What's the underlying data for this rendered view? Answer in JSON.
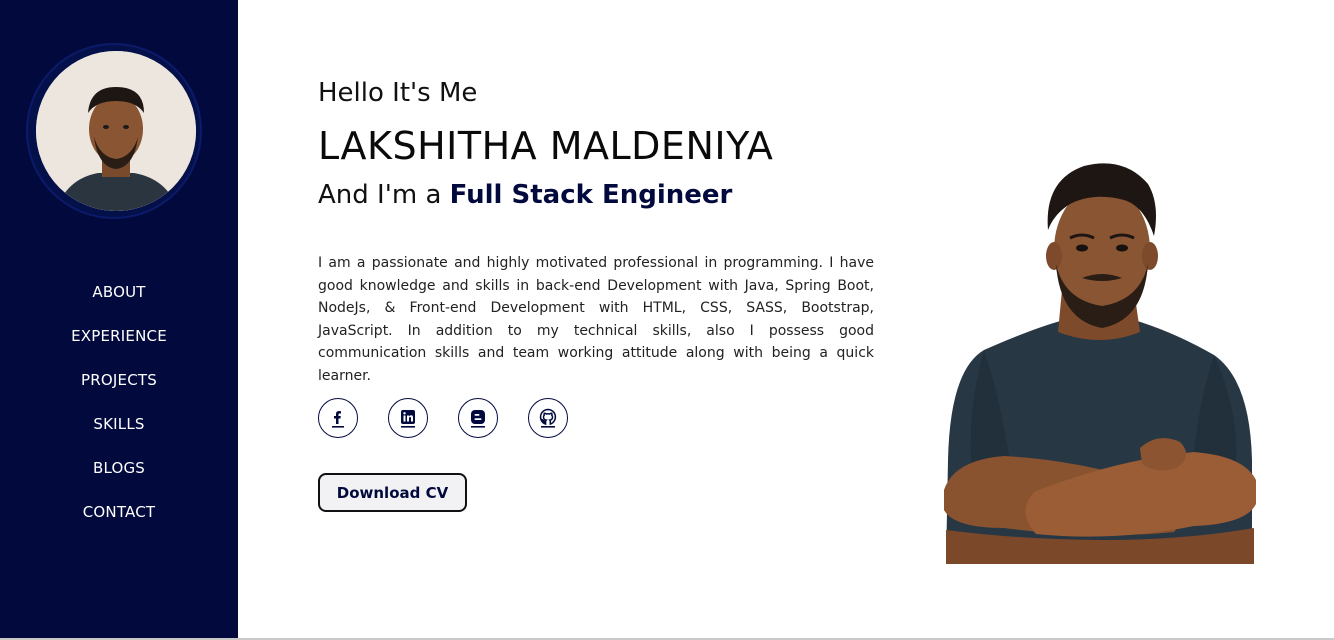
{
  "sidebar": {
    "bg_color": "#020a3d",
    "nav_items": [
      {
        "label": "ABOUT"
      },
      {
        "label": "EXPERIENCE"
      },
      {
        "label": "PROJECTS"
      },
      {
        "label": "SKILLS"
      },
      {
        "label": "BLOGS"
      },
      {
        "label": "CONTACT"
      }
    ]
  },
  "hero": {
    "greeting": "Hello It's Me",
    "name": "LAKSHITHA MALDENIYA",
    "role_prefix": "And I'm a ",
    "role_title": "Full Stack Engineer",
    "bio": "I am a passionate and highly motivated professional in programming. I have good knowledge and skills in back-end Development with Java, Spring Boot, NodeJs, & Front-end Development with HTML, CSS, SASS, Bootstrap, JavaScript. In addition to my technical skills, also I possess good communication skills and team working attitude along with being a quick learner.",
    "socials": [
      {
        "icon": "facebook-icon"
      },
      {
        "icon": "linkedin-icon"
      },
      {
        "icon": "blogger-icon"
      },
      {
        "icon": "github-icon"
      }
    ],
    "cv_button": "Download CV"
  },
  "colors": {
    "accent": "#020a3d",
    "background": "#ffffff"
  }
}
